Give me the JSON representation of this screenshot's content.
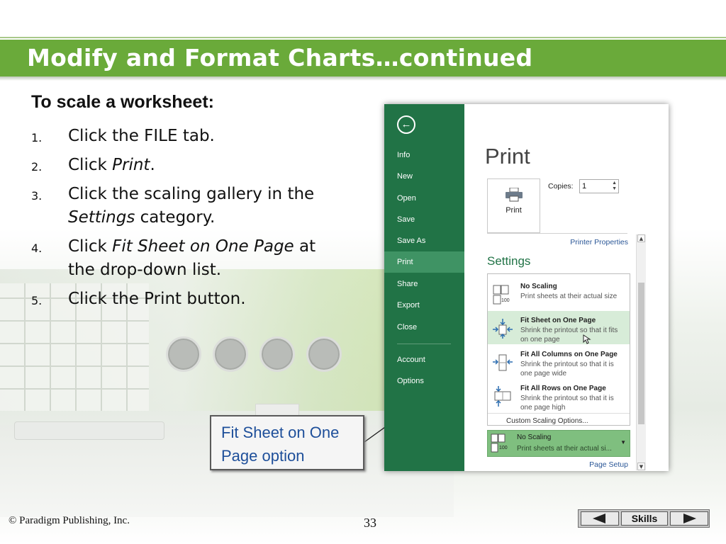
{
  "slide": {
    "title": "Modify and Format Charts…continued",
    "heading": "To scale a worksheet:",
    "steps": [
      {
        "num": "1.",
        "pre": "Click the FILE tab.",
        "em": "",
        "post": ""
      },
      {
        "num": "2.",
        "pre": "Click ",
        "em": "Print",
        "post": "."
      },
      {
        "num": "3.",
        "pre": "Click the scaling gallery in the ",
        "em": "Settings",
        "post": " category."
      },
      {
        "num": "4.",
        "pre": "Click ",
        "em": "Fit Sheet on One Page",
        "post": " at the drop-down list."
      },
      {
        "num": "5.",
        "pre": "Click the Print button.",
        "em": "",
        "post": ""
      }
    ],
    "callout_line1": "Fit Sheet on One",
    "callout_line2": "Page option"
  },
  "excel": {
    "nav_items": [
      "Info",
      "New",
      "Open",
      "Save",
      "Save As",
      "Print",
      "Share",
      "Export",
      "Close",
      "Account",
      "Options"
    ],
    "selected_nav": "Print",
    "print_title": "Print",
    "print_button": "Print",
    "copies_label": "Copies:",
    "copies_value": "1",
    "printer_properties": "Printer Properties",
    "settings_label": "Settings",
    "options": [
      {
        "title": "No Scaling",
        "desc": "Print sheets at their actual size",
        "icon": "no-scaling-icon",
        "badge": "100"
      },
      {
        "title": "Fit Sheet on One Page",
        "desc": "Shrink the printout so that it fits on one page",
        "icon": "fit-sheet-icon"
      },
      {
        "title": "Fit All Columns on One Page",
        "desc": "Shrink the printout so that it is one page wide",
        "icon": "fit-columns-icon"
      },
      {
        "title": "Fit All Rows on One Page",
        "desc": "Shrink the printout so that it is one page high",
        "icon": "fit-rows-icon"
      }
    ],
    "custom_scaling": "Custom Scaling Options...",
    "current_title": "No Scaling",
    "current_desc": "Print sheets at their actual si...",
    "current_badge": "100",
    "page_setup": "Page Setup"
  },
  "footer": {
    "copyright": "© Paradigm Publishing, Inc.",
    "page_number": "33",
    "skills_label": "Skills"
  },
  "colors": {
    "title_bar": "#6aaa3a",
    "excel_green": "#217346",
    "callout_text": "#1e4f9a",
    "highlight": "#d7ecd8"
  }
}
